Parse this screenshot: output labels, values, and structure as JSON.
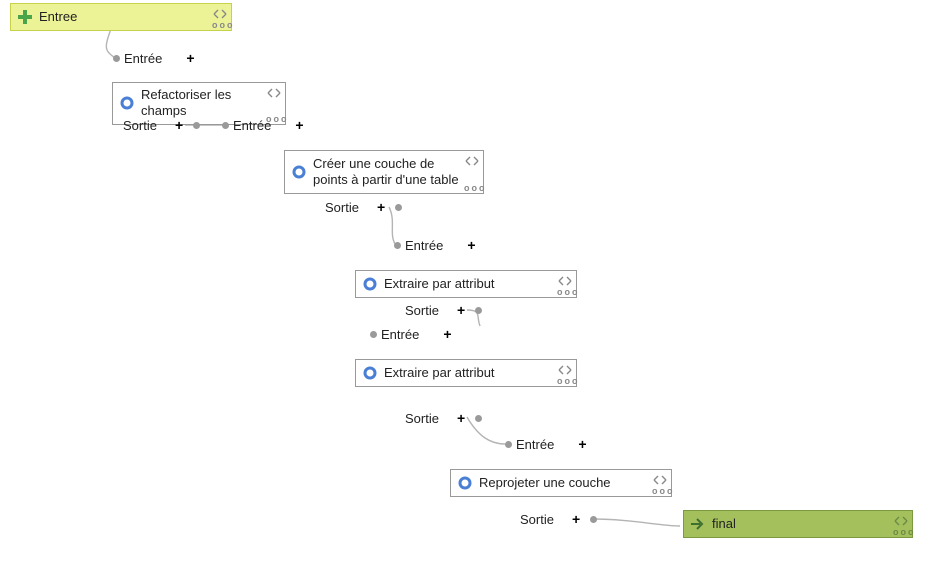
{
  "labels": {
    "in": "Entrée",
    "out": "Sortie"
  },
  "nodes": {
    "input": {
      "title": "Entree"
    },
    "refactor": {
      "title": "Refactoriser les champs"
    },
    "create": {
      "title": "Créer une couche de points à partir d'une table"
    },
    "extract1": {
      "title": "Extraire par attribut"
    },
    "extract2": {
      "title": "Extraire par attribut"
    },
    "reproj": {
      "title": "Reprojeter une couche"
    },
    "output": {
      "title": "final"
    }
  },
  "more": "ooo"
}
